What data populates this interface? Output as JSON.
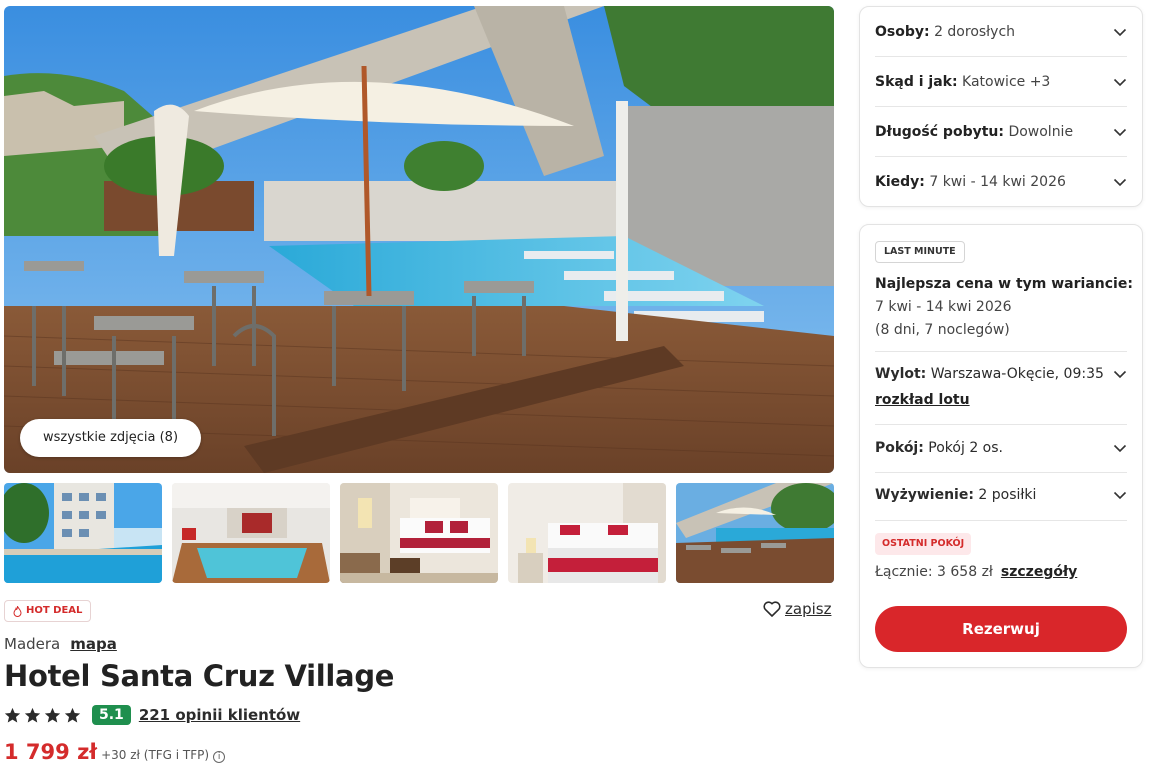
{
  "gallery": {
    "all_photos_label": "wszystkie zdjęcia (8)",
    "thumbnails": [
      "hotel-pool-exterior",
      "indoor-pool",
      "bedroom-double",
      "bedroom-twin",
      "terrace-pool"
    ]
  },
  "hotel": {
    "hot_deal": "HOT DEAL",
    "save_label": "zapisz",
    "region": "Madera",
    "map_link": "mapa",
    "name": "Hotel Santa Cruz Village",
    "stars": 4,
    "score": "5.1",
    "reviews_label": "221 opinii klientów",
    "price": "1 799 zł",
    "price_extra": "+30 zł (TFG i TFP)"
  },
  "filters": [
    {
      "label": "Osoby:",
      "value": "2 dorosłych"
    },
    {
      "label": "Skąd i jak:",
      "value": "Katowice +3"
    },
    {
      "label": "Długość pobytu:",
      "value": "Dowolnie"
    },
    {
      "label": "Kiedy:",
      "value": "7 kwi - 14 kwi 2026"
    }
  ],
  "offer": {
    "tag": "LAST MINUTE",
    "best_title": "Najlepsza cena w tym wariancie:",
    "dates": "7 kwi - 14 kwi 2026",
    "nights": "(8 dni, 7 noclegów)",
    "flight_label": "Wylot:",
    "flight_value": "Warszawa-Okęcie, 09:35",
    "flight_link": "rozkład lotu",
    "room_label": "Pokój:",
    "room_value": "Pokój 2 os.",
    "board_label": "Wyżywienie:",
    "board_value": "2 posiłki",
    "last_room_tag": "OSTATNI POKÓJ",
    "total_label": "Łącznie: 3 658 zł",
    "details_link": "szczegóły",
    "reserve_button": "Rezerwuj"
  },
  "colors": {
    "accent_red": "#d9262a",
    "score_green": "#1f8f4e"
  }
}
